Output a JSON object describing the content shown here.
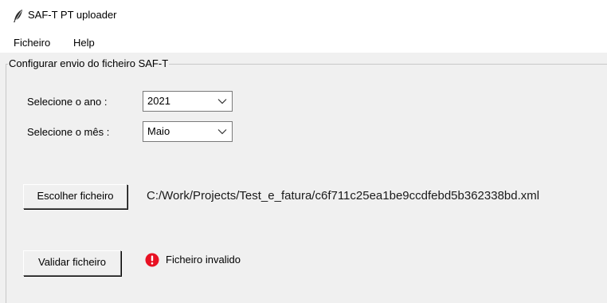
{
  "window": {
    "title": "SAF-T PT uploader",
    "icon": "feather-icon"
  },
  "menu": {
    "items": [
      "Ficheiro",
      "Help"
    ]
  },
  "frame": {
    "title": "Configurar envio do ficheiro SAF-T"
  },
  "form": {
    "year_label": "Selecione o ano :",
    "year_value": "2021",
    "month_label": "Selecione o mês :",
    "month_value": "Maio"
  },
  "file": {
    "choose_button": "Escolher ficheiro",
    "path": "C:/Work/Projects/Test_e_fatura/c6f711c25ea1be9ccdfebd5b362338bd.xml"
  },
  "validation": {
    "button": "Validar ficheiro",
    "status": "Ficheiro invalido",
    "status_icon": "error-icon",
    "status_color": "#e81123"
  }
}
